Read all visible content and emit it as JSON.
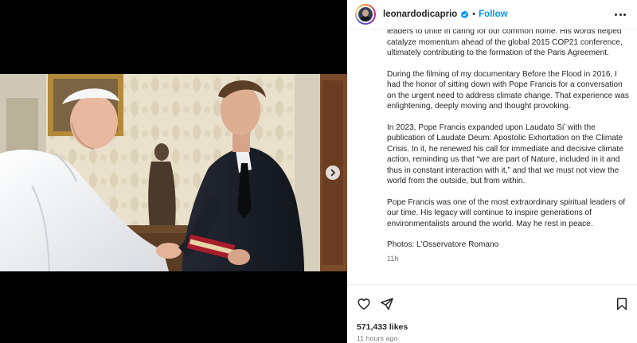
{
  "post": {
    "username": "leonardodicaprio",
    "separator": "•",
    "follow_label": "Follow",
    "caption_paragraphs": [
      "leaders to unite in caring for our common home. His words helped catalyze momentum ahead of the global 2015 COP21 conference, ultimately contributing to the formation of the Paris Agreement.",
      "During the filming of my documentary Before the Flood in 2016, I had the honor of sitting down with Pope Francis for a conversation on the urgent need to address climate change. That experience was enlightening, deeply moving and thought provoking.",
      "In 2023, Pope Francis expanded upon Laudato Si’ with the publication of Laudate Deum: Apostolic Exhortation on the Climate Crisis. In it, he renewed his call for immediate and decisive climate action, reminding us that “we are part of Nature, included in it and thus in constant interaction with it,” and that we must not view the world from the outside, but from within.",
      "Pope Francis was one of the most extraordinary spiritual leaders of our time. His legacy will continue to inspire generations of environmentalists around the world. May he rest in peace."
    ],
    "photo_credit": "Photos: L’Osservatore Romano",
    "caption_time": "11h",
    "likes": "571,433 likes",
    "posted_ago": "11 hours ago"
  },
  "icons": {
    "like": "heart-icon",
    "share": "send-icon",
    "save": "bookmark-icon",
    "more": "more-options-icon",
    "next": "chevron-right-icon",
    "verified": "verified-badge-icon"
  },
  "colors": {
    "follow": "#0095f6",
    "verified": "#0095f6",
    "secondary_text": "#737373",
    "text": "#262626"
  }
}
